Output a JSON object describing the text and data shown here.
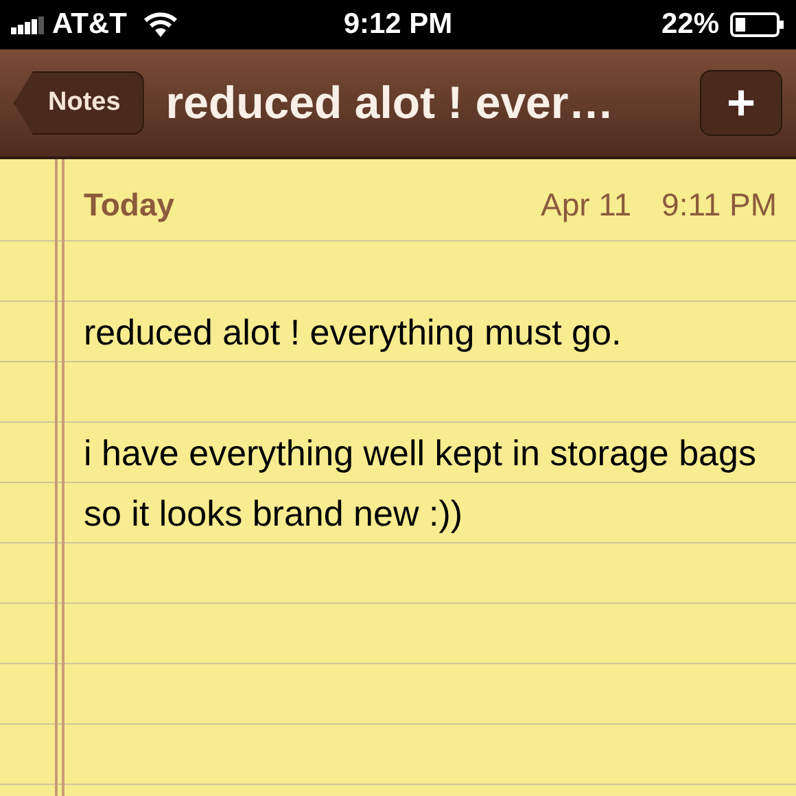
{
  "status_bar": {
    "carrier": "AT&T",
    "time": "9:12 PM",
    "battery": "22%"
  },
  "nav_bar": {
    "back": "Notes",
    "title": "reduced alot ! ever…",
    "add": "+"
  },
  "note": {
    "day": "Today",
    "date": "Apr 11",
    "time": "9:11 PM",
    "body": [
      "reduced alot ! everything must go.",
      "i have everything well kept in storage bags so it looks brand new :))"
    ]
  }
}
